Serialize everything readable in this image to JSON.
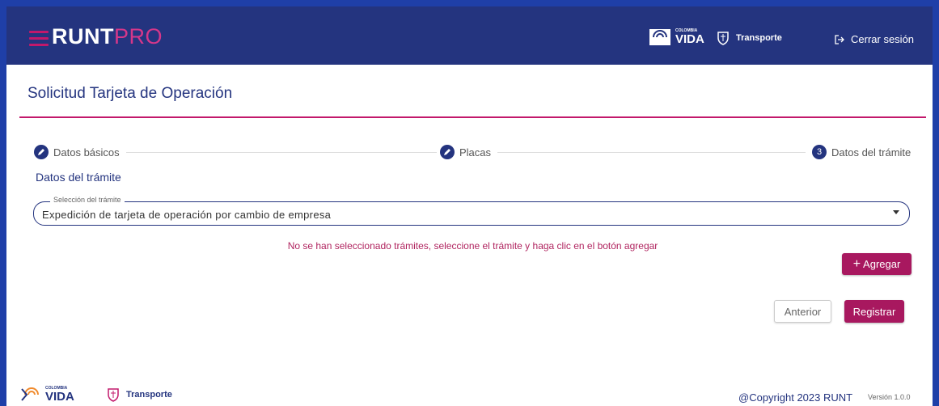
{
  "header": {
    "brand_bold": "RUNT",
    "brand_light": "PRO",
    "gov_small": "COLOMBIA",
    "gov_big": "VIDA",
    "transport": "Transporte",
    "logout_label": "Cerrar sesión"
  },
  "page": {
    "title": "Solicitud Tarjeta de Operación"
  },
  "stepper": {
    "steps": [
      {
        "label": "Datos básicos",
        "icon": "pencil-icon"
      },
      {
        "label": "Placas",
        "icon": "pencil-icon"
      },
      {
        "label": "Datos del trámite",
        "number": "3"
      }
    ]
  },
  "form": {
    "section_title": "Datos del trámite",
    "select_legend": "Selección del trámite",
    "select_value": "Expedición de tarjeta de operación por cambio de empresa",
    "warning": "No se han seleccionado trámites, seleccione el trámite y haga clic en el botón agregar",
    "add_label": "Agregar",
    "prev_label": "Anterior",
    "register_label": "Registrar"
  },
  "footer": {
    "gov_small": "COLOMBIA",
    "gov_big": "VIDA",
    "transport": "Transporte",
    "copyright": "@Copyright 2023 RUNT",
    "version": "Versión 1.0.0"
  },
  "colors": {
    "primary": "#24347f",
    "accent": "#a8185f",
    "frame": "#1f3fa8"
  }
}
